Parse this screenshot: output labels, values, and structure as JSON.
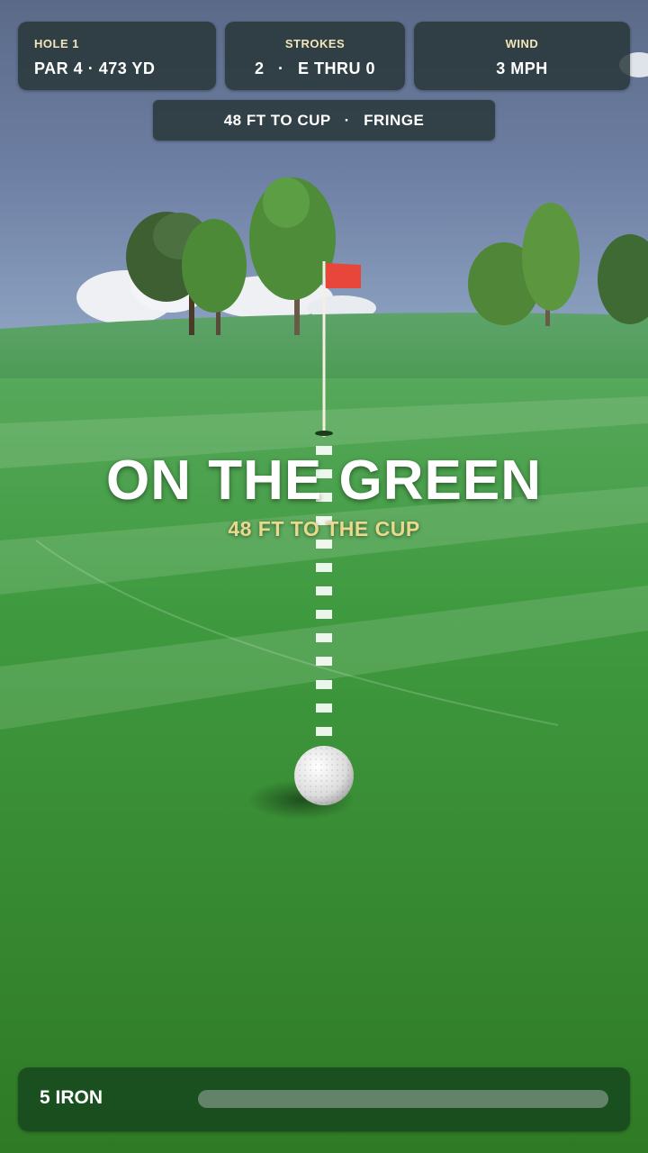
{
  "hud": {
    "hole": {
      "label": "HOLE 1",
      "par": "PAR 4",
      "yardage": "473 YD"
    },
    "strokes": {
      "label": "STROKES",
      "count": "2",
      "score": "E THRU 0"
    },
    "wind": {
      "label": "WIND",
      "speed": "3 MPH"
    },
    "distance": {
      "to_cup": "48 FT TO CUP",
      "lie": "FRINGE"
    }
  },
  "banner": {
    "title": "ON THE GREEN",
    "subtitle": "48 FT TO THE CUP"
  },
  "club": {
    "name": "5 IRON"
  },
  "colors": {
    "flag": "#e8463a",
    "banner_sub": "#e9d98a",
    "panel": "#263434",
    "grass": "#3f8a2e"
  }
}
